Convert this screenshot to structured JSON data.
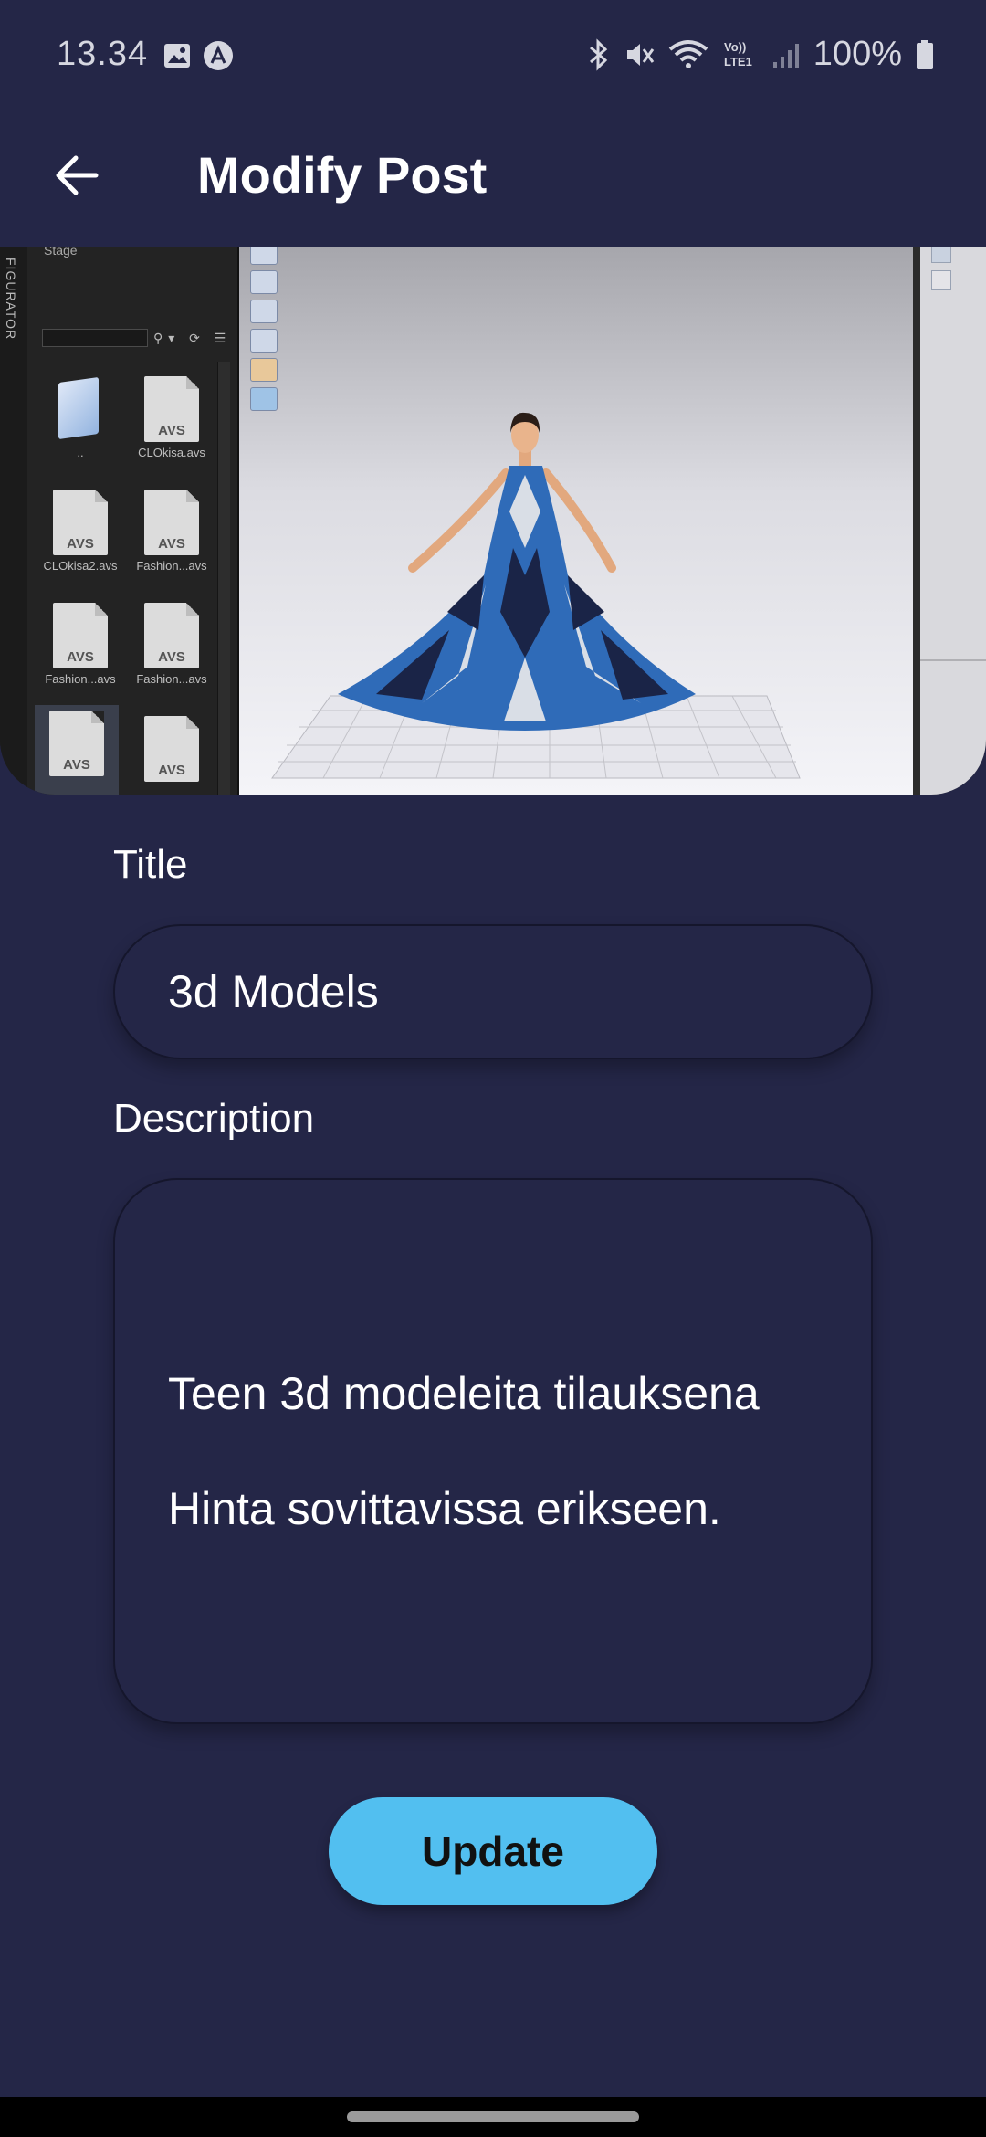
{
  "status_bar": {
    "time": "13.34",
    "battery": "100%",
    "left_icons": [
      "image-icon",
      "app-a-icon"
    ],
    "right_icons": [
      "bluetooth-icon",
      "mute-icon",
      "wifi-icon",
      "volte-icon",
      "signal-icon",
      "battery-icon"
    ],
    "volte_label": "Vo))\nLTE1"
  },
  "app_bar": {
    "title": "Modify Post",
    "back_icon": "arrow-left-icon"
  },
  "post_image": {
    "description_side_rail": "FIGURATOR",
    "panel_header": "Stage",
    "panel_tools": "⚲▾ ⟳ ☰",
    "files": [
      {
        "name": "..",
        "kind": "folder"
      },
      {
        "name": "CLOkisa.avs",
        "kind": "AVS"
      },
      {
        "name": "CLOkisa2.avs",
        "kind": "AVS"
      },
      {
        "name": "Fashion...avs",
        "kind": "AVS"
      },
      {
        "name": "Fashion...avs",
        "kind": "AVS"
      },
      {
        "name": "Fashion...avs",
        "kind": "AVS"
      },
      {
        "name": "AVS",
        "kind": "AVS"
      },
      {
        "name": "AVS",
        "kind": "AVS"
      }
    ],
    "file_label": "AVS"
  },
  "form": {
    "title_label": "Title",
    "title_value": "3d Models",
    "description_label": "Description",
    "description_lines": [
      "Teen 3d modeleita tilauksena",
      "Hinta sovittavissa erikseen."
    ],
    "update_label": "Update"
  },
  "colors": {
    "background": "#242647",
    "button": "#52bff0",
    "text": "#ffffff"
  }
}
